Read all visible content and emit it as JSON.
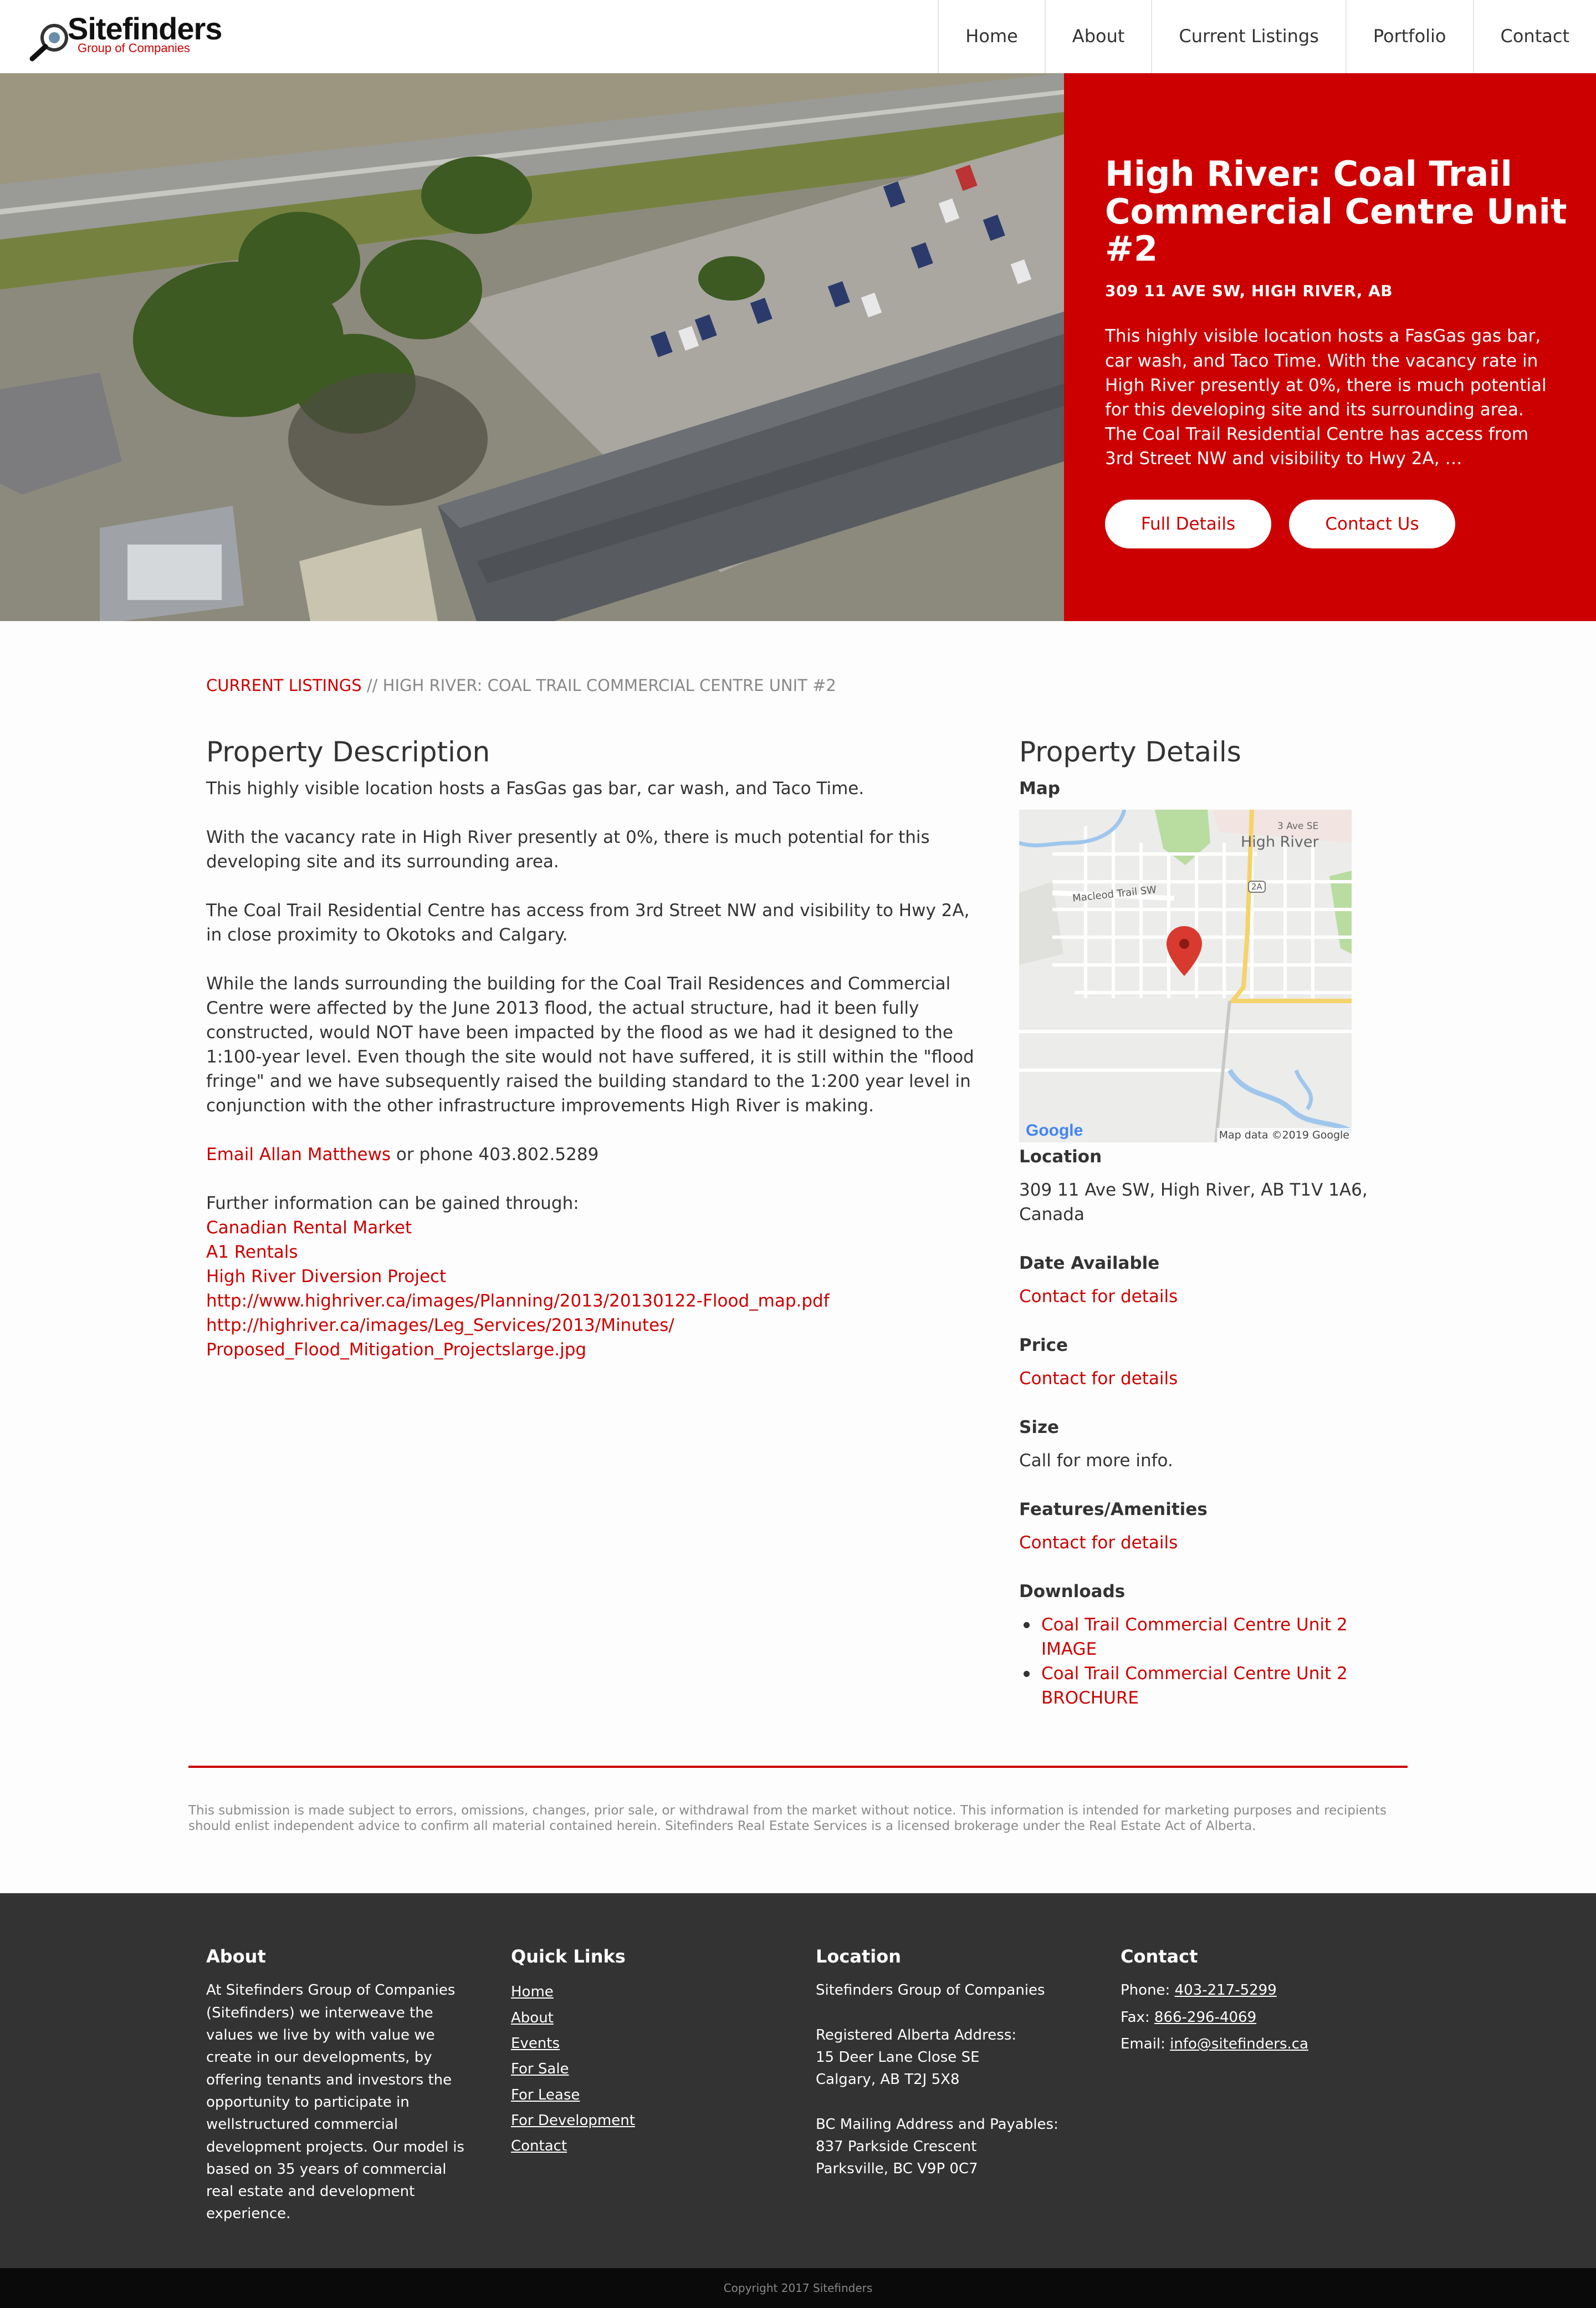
{
  "header": {
    "logo_name": "Sitefinders",
    "logo_sub": "Group of Companies",
    "nav": [
      "Home",
      "About",
      "Current Listings",
      "Portfolio",
      "Contact"
    ]
  },
  "hero": {
    "title": "High River: Coal Trail Commercial Centre Unit #2",
    "address": "309 11 AVE SW, HIGH RIVER, AB",
    "text": "This highly visible location hosts a FasGas gas bar, car wash, and Taco Time. With the vacancy rate in High River presently at 0%, there is much potential for this developing site and its surrounding area. The Coal Trail Residential Centre has access from 3rd Street NW and visibility to Hwy 2A, …",
    "full_details_label": "Full Details",
    "contact_label": "Contact Us"
  },
  "breadcrumb": {
    "link": "CURRENT LISTINGS",
    "separator": " // ",
    "current": "HIGH RIVER: COAL TRAIL COMMERCIAL CENTRE UNIT #2"
  },
  "description": {
    "title": "Property Description",
    "paragraphs": [
      "This highly visible location hosts a FasGas gas bar, car wash, and Taco Time.",
      "With the vacancy rate in High River presently at 0%, there is much potential for this developing site and its surrounding area.",
      "The Coal Trail Residential Centre has access from 3rd Street NW and visibility to Hwy 2A, in close proximity to Okotoks and Calgary.",
      "While the lands surrounding the building for the Coal Trail Residences and Commercial Centre were affected by the June 2013 flood, the actual structure, had it been fully constructed, would NOT have been impacted by the flood as we had it designed to the 1:100-year level. Even though the site would not have suffered, it is still within the \"flood fringe\" and we have subsequently raised the building standard to the 1:200 year level in conjunction with the other infrastructure improvements High River is making."
    ],
    "email_link": "Email Allan Matthews",
    "phone_text": " or phone 403.802.5289",
    "further_info": "Further information can be gained through:",
    "links": [
      "Canadian Rental Market",
      "A1 Rentals",
      "High River Diversion Project",
      "http://www.highriver.ca/images/Planning/2013/20130122-Flood_map.pdf",
      "http://highriver.ca/images/Leg_Services/2013/Minutes/\nProposed_Flood_Mitigation_Projectslarge.jpg"
    ]
  },
  "details": {
    "title": "Property Details",
    "map_label": "Map",
    "map": {
      "town_label": "High River",
      "street_label": "3 Ave SE",
      "road_label": "Macleod Trail SW",
      "highway_shield": "2A",
      "google_label": "Google",
      "attribution": "Map data ©2019 Google"
    },
    "location_label": "Location",
    "location_value": "309 11 Ave SW, High River, AB T1V 1A6, Canada",
    "date_label": "Date Available",
    "date_value": "Contact for details",
    "price_label": "Price",
    "price_value": "Contact for details",
    "size_label": "Size",
    "size_value": "Call for more info.",
    "features_label": "Features/Amenities",
    "features_value": "Contact for details",
    "downloads_label": "Downloads",
    "downloads": [
      "Coal Trail Commercial Centre Unit 2 IMAGE",
      "Coal Trail Commercial Centre Unit 2 BROCHURE"
    ]
  },
  "disclaimer": "This submission is made subject to errors, omissions, changes, prior sale, or withdrawal from the market without notice. This information is intended for marketing purposes and recipients should enlist independent advice to confirm all material contained herein. Sitefinders Real Estate Services is a licensed brokerage under the Real Estate Act of Alberta.",
  "footer": {
    "about_title": "About",
    "about_text": "At Sitefinders Group of Companies (Sitefinders) we interweave the values we live by with value we create in our developments, by offering tenants and investors the opportunity to participate in wellstructured commercial development projects. Our model is based on 35 years of commercial real estate and development experience.",
    "quick_links_title": "Quick Links",
    "quick_links": [
      "Home",
      "About",
      "Events",
      "For Sale",
      "For Lease",
      "For Development",
      "Contact"
    ],
    "location_title": "Location",
    "location_company": "Sitefinders Group of Companies",
    "alberta_heading": "Registered Alberta Address:",
    "alberta_line1": "15 Deer Lane Close SE",
    "alberta_line2": "Calgary, AB T2J 5X8",
    "bc_heading": "BC Mailing Address and Payables:",
    "bc_line1": "837 Parkside Crescent",
    "bc_line2": "Parksville, BC V9P 0C7",
    "contact_title": "Contact",
    "phone_label": "Phone: ",
    "phone": "403-217-5299",
    "fax_label": "Fax: ",
    "fax": "866-296-4069",
    "email_label": "Email: ",
    "email": "info@sitefinders.ca"
  },
  "copyright": "Copyright 2017 Sitefinders",
  "colors": {
    "brand_red": "#cc0000",
    "footer_bg": "#333333",
    "copyright_bg": "#0a0a0a"
  }
}
